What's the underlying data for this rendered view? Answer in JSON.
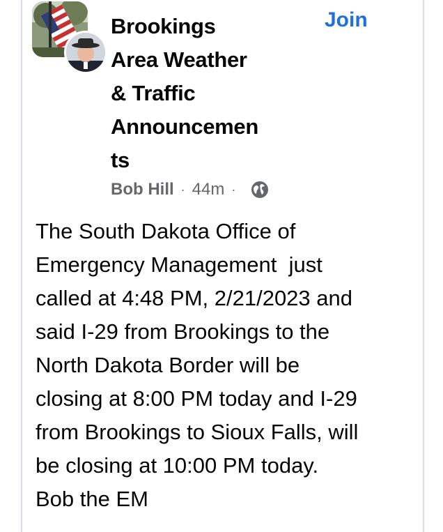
{
  "post": {
    "group_name": "Brookings\nArea Weather\n& Traffic\nAnnouncemen\nts",
    "join_label": "Join",
    "author": "Bob Hill",
    "time": "44m",
    "separator": "·",
    "audience_icon": "globe-icon",
    "body": "The South Dakota Office of\nEmergency Management  just\ncalled at 4:48 PM, 2/21/2023 and\nsaid I-29 from Brookings to the\nNorth Dakota Border will be\nclosing at 8:00 PM today and I-29\nfrom Brookings to Sioux Falls, will\nbe closing at 10:00 PM today.\nBob the EM"
  },
  "colors": {
    "join_blue": "#216fdb",
    "meta_gray": "#65676b",
    "text": "#050505"
  }
}
